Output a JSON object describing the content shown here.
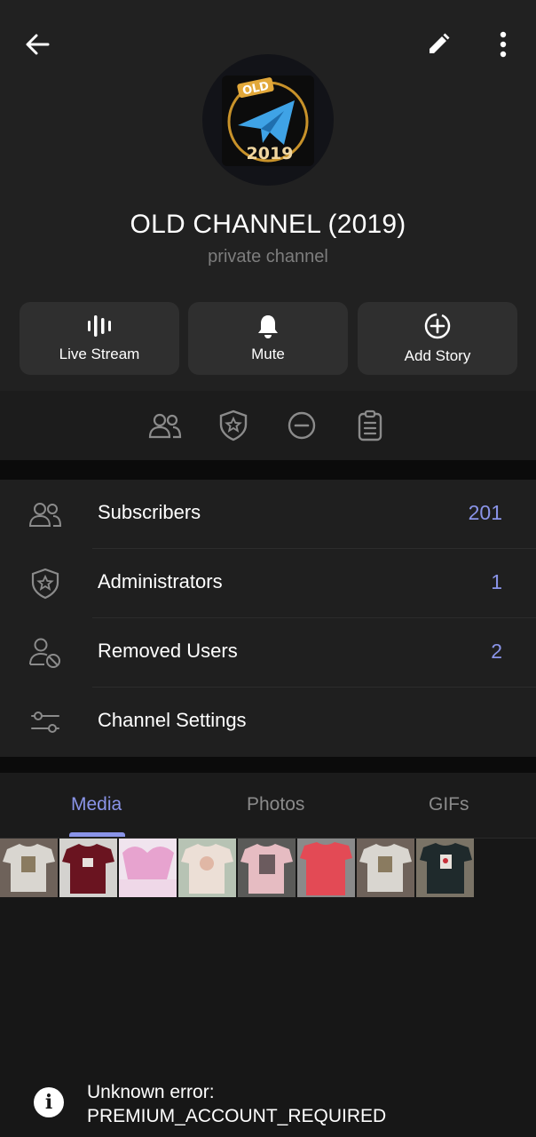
{
  "topbar": {
    "back_icon": "arrow-left-icon",
    "edit_icon": "pencil-icon",
    "more_icon": "more-vertical-icon"
  },
  "channel": {
    "avatar_badge": "OLD",
    "avatar_year": "2019",
    "title": "OLD CHANNEL (2019)",
    "subtitle": "private channel"
  },
  "actions": [
    {
      "label": "Live Stream",
      "icon": "live-stream-icon"
    },
    {
      "label": "Mute",
      "icon": "bell-icon"
    },
    {
      "label": "Add Story",
      "icon": "add-story-icon"
    }
  ],
  "iconbar": [
    "people-icon",
    "shield-star-icon",
    "minus-circle-icon",
    "clipboard-icon"
  ],
  "list": {
    "rows": [
      {
        "label": "Subscribers",
        "value": "201",
        "icon": "people-icon"
      },
      {
        "label": "Administrators",
        "value": "1",
        "icon": "shield-star-icon"
      },
      {
        "label": "Removed Users",
        "value": "2",
        "icon": "user-blocked-icon"
      },
      {
        "label": "Channel Settings",
        "value": "",
        "icon": "sliders-icon"
      }
    ]
  },
  "tabs": [
    {
      "label": "Media",
      "active": true
    },
    {
      "label": "Photos",
      "active": false
    },
    {
      "label": "GIFs",
      "active": false
    }
  ],
  "toast": {
    "line1": "Unknown error:",
    "line2": "PREMIUM_ACCOUNT_REQUIRED"
  },
  "colors": {
    "accent": "#8a94e8",
    "background": "#171717",
    "header": "#212121",
    "button": "#2f2f2f"
  }
}
